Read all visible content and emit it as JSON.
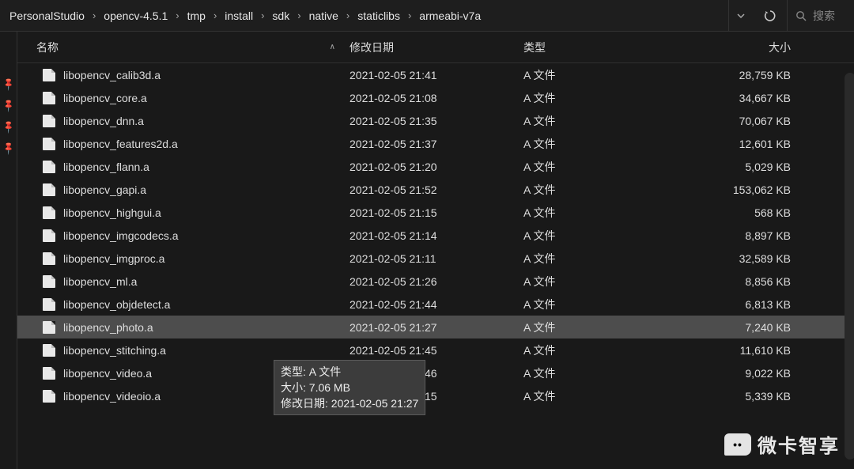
{
  "breadcrumb": {
    "items": [
      {
        "label": "PersonalStudio"
      },
      {
        "label": "opencv-4.5.1"
      },
      {
        "label": "tmp"
      },
      {
        "label": "install"
      },
      {
        "label": "sdk"
      },
      {
        "label": "native"
      },
      {
        "label": "staticlibs"
      },
      {
        "label": "armeabi-v7a"
      }
    ]
  },
  "search": {
    "placeholder": "搜索"
  },
  "columns": {
    "name": "名称",
    "date": "修改日期",
    "type": "类型",
    "size": "大小"
  },
  "tooltip": {
    "type_label": "类型: A 文件",
    "size_label": "大小: 7.06 MB",
    "date_label": "修改日期: 2021-02-05 21:27"
  },
  "files": [
    {
      "name": "libopencv_calib3d.a",
      "date": "2021-02-05 21:41",
      "type": "A 文件",
      "size": "28,759 KB",
      "selected": false
    },
    {
      "name": "libopencv_core.a",
      "date": "2021-02-05 21:08",
      "type": "A 文件",
      "size": "34,667 KB",
      "selected": false
    },
    {
      "name": "libopencv_dnn.a",
      "date": "2021-02-05 21:35",
      "type": "A 文件",
      "size": "70,067 KB",
      "selected": false
    },
    {
      "name": "libopencv_features2d.a",
      "date": "2021-02-05 21:37",
      "type": "A 文件",
      "size": "12,601 KB",
      "selected": false
    },
    {
      "name": "libopencv_flann.a",
      "date": "2021-02-05 21:20",
      "type": "A 文件",
      "size": "5,029 KB",
      "selected": false
    },
    {
      "name": "libopencv_gapi.a",
      "date": "2021-02-05 21:52",
      "type": "A 文件",
      "size": "153,062 KB",
      "selected": false
    },
    {
      "name": "libopencv_highgui.a",
      "date": "2021-02-05 21:15",
      "type": "A 文件",
      "size": "568 KB",
      "selected": false
    },
    {
      "name": "libopencv_imgcodecs.a",
      "date": "2021-02-05 21:14",
      "type": "A 文件",
      "size": "8,897 KB",
      "selected": false
    },
    {
      "name": "libopencv_imgproc.a",
      "date": "2021-02-05 21:11",
      "type": "A 文件",
      "size": "32,589 KB",
      "selected": false
    },
    {
      "name": "libopencv_ml.a",
      "date": "2021-02-05 21:26",
      "type": "A 文件",
      "size": "8,856 KB",
      "selected": false
    },
    {
      "name": "libopencv_objdetect.a",
      "date": "2021-02-05 21:44",
      "type": "A 文件",
      "size": "6,813 KB",
      "selected": false
    },
    {
      "name": "libopencv_photo.a",
      "date": "2021-02-05 21:27",
      "type": "A 文件",
      "size": "7,240 KB",
      "selected": true
    },
    {
      "name": "libopencv_stitching.a",
      "date": "2021-02-05 21:45",
      "type": "A 文件",
      "size": "11,610 KB",
      "selected": false
    },
    {
      "name": "libopencv_video.a",
      "date": "2021-02-05 21:46",
      "type": "A 文件",
      "size": "9,022 KB",
      "selected": false
    },
    {
      "name": "libopencv_videoio.a",
      "date": "2021-02-05 21:15",
      "type": "A 文件",
      "size": "5,339 KB",
      "selected": false
    }
  ],
  "watermark": {
    "bubble": "••",
    "text": "微卡智享"
  }
}
